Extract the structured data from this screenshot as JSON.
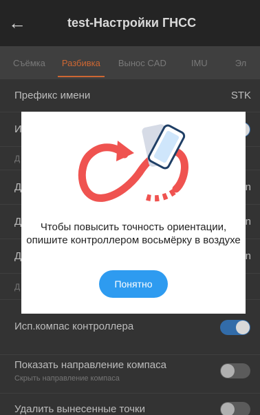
{
  "appbar": {
    "back_icon": "arrow-left-icon",
    "title": "test-Настройки ГНСС"
  },
  "tabs": [
    {
      "label": "Съёмка",
      "active": false
    },
    {
      "label": "Разбивка",
      "active": true
    },
    {
      "label": "Вынос CAD",
      "active": false
    },
    {
      "label": "IMU",
      "active": false
    },
    {
      "label": "Эл",
      "active": false
    }
  ],
  "colors": {
    "accent": "#f17a3d",
    "toggle_on": "#3b7fc7",
    "button": "#2e9bf0"
  },
  "settings": {
    "prefix": {
      "label": "Префикс имени",
      "value": "STK"
    },
    "row_2": {
      "label_fragment": "И",
      "toggle_on": true
    },
    "section_1": {
      "label_fragment": "Д"
    },
    "row_3": {
      "label_fragment": "Д",
      "value_fragment": "n"
    },
    "row_4": {
      "label_fragment": "Д",
      "value_fragment": "n"
    },
    "row_5": {
      "label_fragment": "Д",
      "value_fragment": "n"
    },
    "section_2": {
      "label_fragment": "Д"
    },
    "compass": {
      "label": "Исп.компас контроллера",
      "toggle_on": true
    },
    "direction": {
      "label": "Показать направление компаса",
      "sub": "Скрыть направление компаса",
      "toggle_on": false
    },
    "delete": {
      "label": "Удалить вынесенные точки",
      "toggle_on": false
    }
  },
  "dialog": {
    "illustration_icon": "figure-eight-calibration-icon",
    "message": "Чтобы повысить точность ориентации, опишите контроллером восьмёрку в воздухе",
    "ok_label": "Понятно"
  }
}
